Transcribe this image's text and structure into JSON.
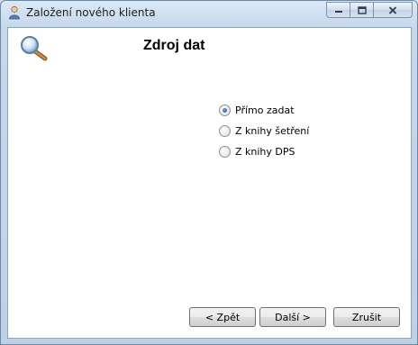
{
  "window": {
    "title": "Založení nového klienta",
    "icon": "user-icon"
  },
  "caption_buttons": {
    "minimize_icon": "minimize-icon",
    "maximize_icon": "maximize-icon",
    "close_icon": "close-icon"
  },
  "content": {
    "heading": "Zdroj dat",
    "heading_icon": "search-icon",
    "options": [
      {
        "label": "Přímo zadat",
        "selected": true
      },
      {
        "label": "Z knihy šetření",
        "selected": false
      },
      {
        "label": "Z knihy DPS",
        "selected": false
      }
    ]
  },
  "buttons": {
    "back_label": "< Zpět",
    "next_label": "Další >",
    "cancel_label": "Zrušit"
  }
}
